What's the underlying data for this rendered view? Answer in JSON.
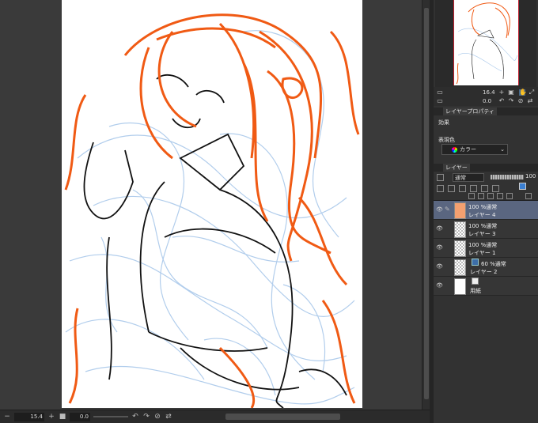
{
  "canvas": {
    "zoom_value": "15.4",
    "rotation_value": "0.0"
  },
  "navigator": {
    "zoom_value": "16.4",
    "rotation_value": "0.0"
  },
  "properties_panel": {
    "tab_label": "レイヤープロパティ",
    "effect_label": "効果",
    "expression_color_label": "表現色",
    "expression_color_value": "カラー"
  },
  "layer_panel": {
    "tab_label": "レイヤー",
    "blend_mode": "通常",
    "opacity": "100",
    "layers": [
      {
        "mode": "100 %通常",
        "name": "レイヤー 4",
        "selected": true
      },
      {
        "mode": "100 %通常",
        "name": "レイヤー 3",
        "selected": false
      },
      {
        "mode": "100 %通常",
        "name": "レイヤー 1",
        "selected": false
      },
      {
        "mode": "60 %通常",
        "name": "レイヤー 2",
        "selected": false
      },
      {
        "mode": "",
        "name": "用紙",
        "selected": false
      }
    ]
  },
  "colors": {
    "accent_selected": "#5a6680",
    "sketch_orange": "#f05a14",
    "sketch_blue": "#a9c8ea",
    "lineart": "#111111"
  }
}
